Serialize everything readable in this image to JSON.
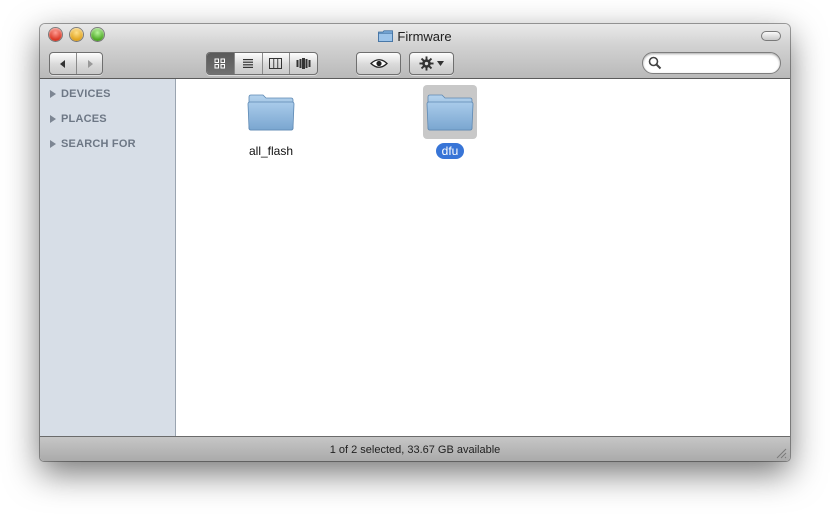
{
  "window": {
    "title": "Firmware"
  },
  "toolbar": {
    "back_icon": "back-arrow-icon",
    "forward_icon": "forward-arrow-icon",
    "view_modes": [
      "icon-view-icon",
      "list-view-icon",
      "column-view-icon",
      "coverflow-view-icon"
    ],
    "active_view": 0,
    "quicklook_icon": "eye-icon",
    "action_icon": "gear-icon"
  },
  "search": {
    "value": "",
    "placeholder": ""
  },
  "sidebar": {
    "sections": [
      {
        "label": "DEVICES"
      },
      {
        "label": "PLACES"
      },
      {
        "label": "SEARCH FOR"
      }
    ]
  },
  "files": [
    {
      "name": "all_flash",
      "kind": "folder",
      "selected": false
    },
    {
      "name": "dfu",
      "kind": "folder",
      "selected": true
    }
  ],
  "status": {
    "text": "1 of 2 selected, 33.67 GB available"
  },
  "colors": {
    "selection": "#3875d7",
    "sidebar": "#d7dee7"
  }
}
